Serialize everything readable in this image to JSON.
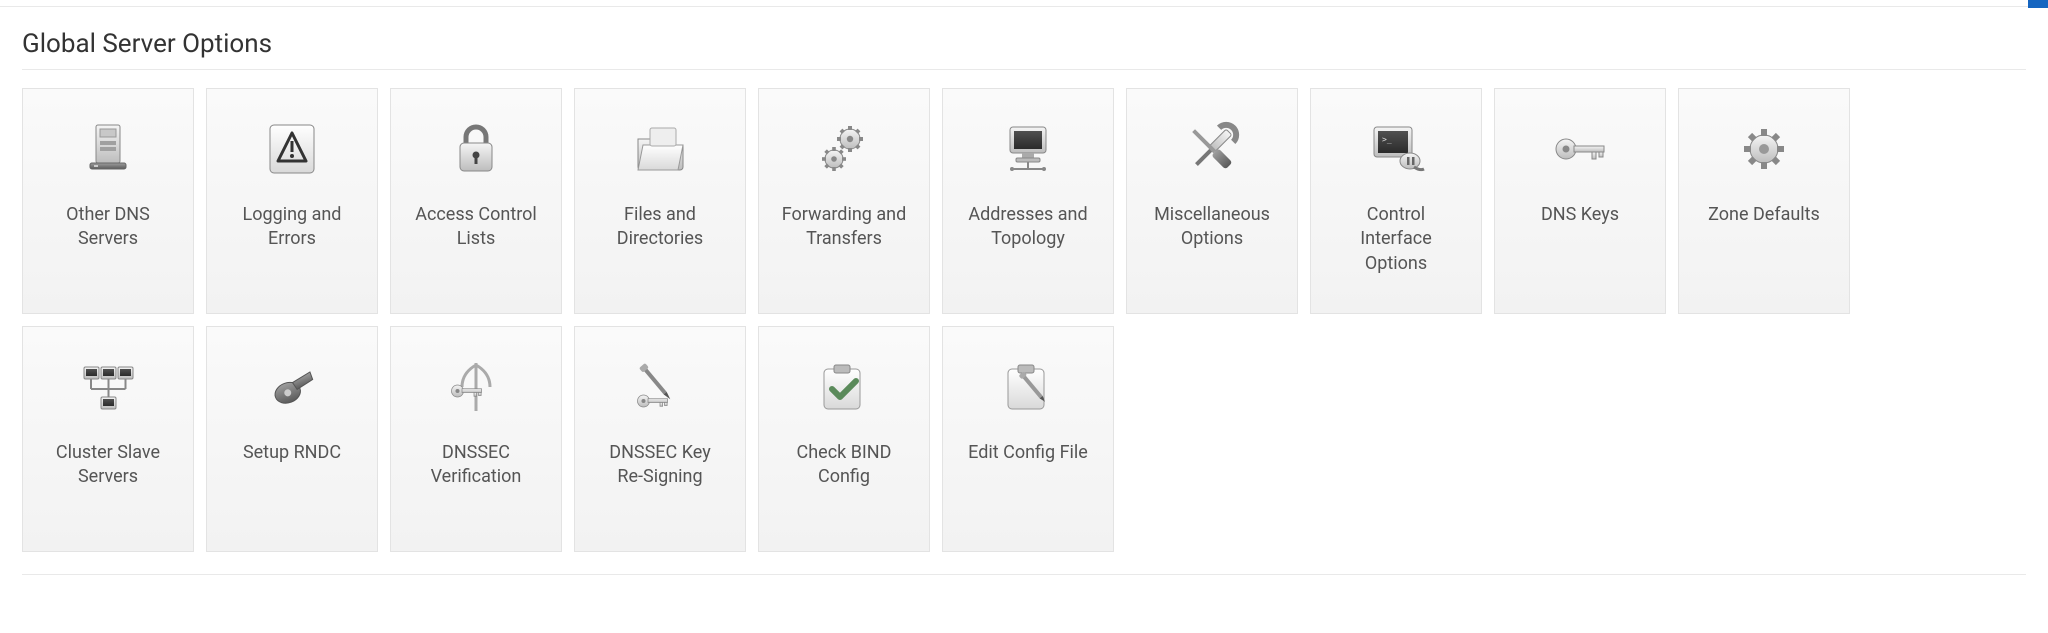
{
  "section_title": "Global Server Options",
  "tiles": [
    {
      "label": "Other DNS\nServers",
      "icon": "server-icon"
    },
    {
      "label": "Logging and\nErrors",
      "icon": "warning-icon"
    },
    {
      "label": "Access Control\nLists",
      "icon": "lock-icon"
    },
    {
      "label": "Files and\nDirectories",
      "icon": "folder-icon"
    },
    {
      "label": "Forwarding and\nTransfers",
      "icon": "gears-icon"
    },
    {
      "label": "Addresses and\nTopology",
      "icon": "monitor-net-icon"
    },
    {
      "label": "Miscellaneous\nOptions",
      "icon": "tools-icon"
    },
    {
      "label": "Control\nInterface\nOptions",
      "icon": "terminal-plug-icon"
    },
    {
      "label": "DNS Keys",
      "icon": "key-icon"
    },
    {
      "label": "Zone Defaults",
      "icon": "gear-icon"
    },
    {
      "label": "Cluster Slave\nServers",
      "icon": "cluster-icon"
    },
    {
      "label": "Setup RNDC",
      "icon": "whistle-icon"
    },
    {
      "label": "DNSSEC\nVerification",
      "icon": "verify-key-icon"
    },
    {
      "label": "DNSSEC Key\nRe-Signing",
      "icon": "resign-key-icon"
    },
    {
      "label": "Check BIND\nConfig",
      "icon": "check-config-icon"
    },
    {
      "label": "Edit Config File",
      "icon": "edit-config-icon"
    }
  ]
}
